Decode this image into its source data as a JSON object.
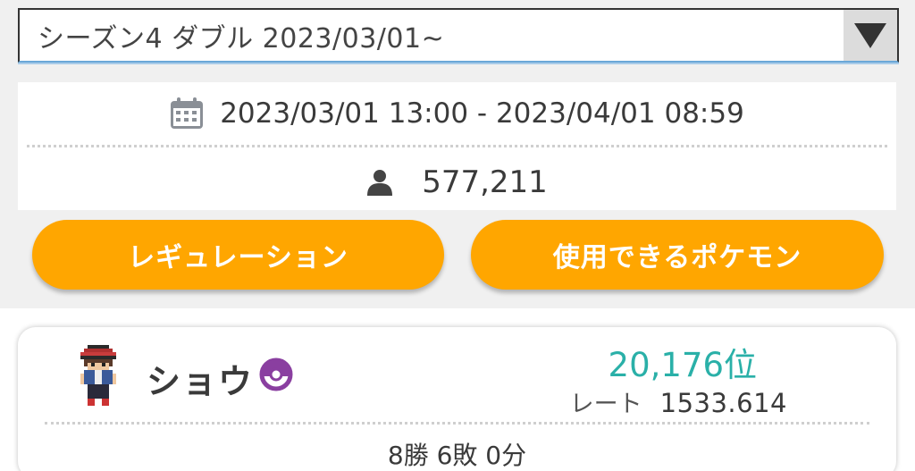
{
  "season_select": {
    "value": "シーズン4 ダブル 2023/03/01~",
    "arrow_icon": "triangle-down-icon"
  },
  "info": {
    "period": "2023/03/01 13:00 - 2023/04/01 08:59",
    "period_icon": "calendar-icon",
    "players": "577,211",
    "players_icon": "person-icon"
  },
  "buttons": {
    "regulation": "レギュレーション",
    "pokemon": "使用できるポケモン"
  },
  "trainer": {
    "name": "ショウ",
    "rank": "20,176位",
    "rate_label": "レート",
    "rate_value": "1533.614",
    "record": "8勝 6敗 0分",
    "ball_icon": "master-ball-icon"
  },
  "colors": {
    "accent_orange": "#ffa600",
    "rank_teal": "#2ab0a8",
    "ball_purple": "#8a3fa0"
  }
}
